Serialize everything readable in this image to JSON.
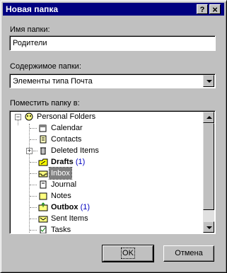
{
  "dialog": {
    "title": "Новая папка",
    "help_button": "?",
    "close_button": "×"
  },
  "name_section": {
    "label": "Имя папки:",
    "value": "Родители"
  },
  "contents_section": {
    "label": "Содержимое папки:",
    "selected": "Элементы типа Почта"
  },
  "location_section": {
    "label": "Поместить папку в:",
    "tree": [
      {
        "label": "Personal Folders",
        "icon": "personal-folders-icon",
        "expanded": true,
        "level": 0
      },
      {
        "label": "Calendar",
        "icon": "calendar-icon",
        "level": 1
      },
      {
        "label": "Contacts",
        "icon": "contacts-icon",
        "level": 1
      },
      {
        "label": "Deleted Items",
        "icon": "deleted-items-icon",
        "level": 1,
        "collapsed": true
      },
      {
        "label": "Drafts",
        "icon": "drafts-icon",
        "level": 1,
        "bold": true,
        "count": "(1)"
      },
      {
        "label": "Inbox",
        "icon": "inbox-icon",
        "level": 1,
        "selected": true
      },
      {
        "label": "Journal",
        "icon": "journal-icon",
        "level": 1
      },
      {
        "label": "Notes",
        "icon": "notes-icon",
        "level": 1
      },
      {
        "label": "Outbox",
        "icon": "outbox-icon",
        "level": 1,
        "bold": true,
        "count": "(1)"
      },
      {
        "label": "Sent Items",
        "icon": "sent-items-icon",
        "level": 1
      },
      {
        "label": "Tasks",
        "icon": "tasks-icon",
        "level": 1
      }
    ]
  },
  "buttons": {
    "ok": "OK",
    "cancel": "Отмена"
  },
  "colors": {
    "title_bar": "#000080",
    "face": "#c0c0c0",
    "count": "#0000c0"
  }
}
